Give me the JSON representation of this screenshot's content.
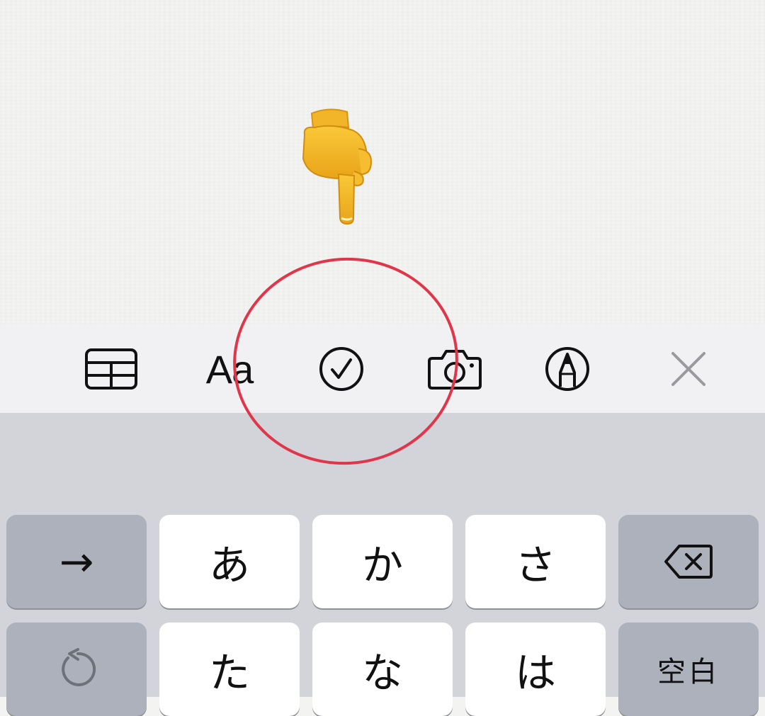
{
  "toolbar": {
    "items": [
      {
        "name": "table",
        "icon": "table-icon"
      },
      {
        "name": "format",
        "label": "Aa",
        "icon": "text-format-icon"
      },
      {
        "name": "checklist",
        "icon": "checklist-icon"
      },
      {
        "name": "camera",
        "icon": "camera-icon"
      },
      {
        "name": "markup",
        "icon": "markup-pen-icon"
      },
      {
        "name": "close",
        "icon": "close-icon"
      }
    ],
    "format_label": "Aa"
  },
  "annotation": {
    "pointer_icon": "pointing-down-hand-emoji",
    "highlight_color": "#e0364a",
    "highlight_target": "checklist"
  },
  "keyboard": {
    "row1": {
      "left": "→",
      "keys": [
        "あ",
        "か",
        "さ"
      ],
      "right_icon": "backspace-icon"
    },
    "row2": {
      "left_icon": "undo-icon",
      "keys": [
        "た",
        "な",
        "は"
      ],
      "right": "空白"
    }
  },
  "colors": {
    "keyboard_bg": "#d3d4da",
    "key_bg": "#ffffff",
    "func_key_bg": "#adb1bc",
    "toolbar_bg": "#f1f1f4"
  }
}
